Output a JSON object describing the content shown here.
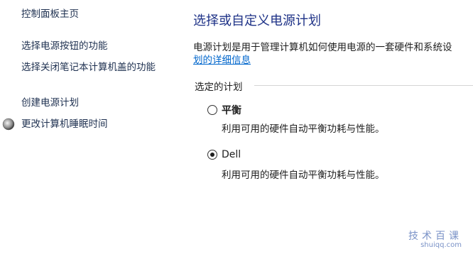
{
  "nav": {
    "home": "控制面板主页",
    "items": [
      {
        "label": "选择电源按钮的功能"
      },
      {
        "label": "选择关闭笔记本计算机盖的功能"
      },
      {
        "label": "创建电源计划"
      },
      {
        "label": "更改计算机睡眠时间",
        "icon": "moon-icon"
      }
    ]
  },
  "main": {
    "title": "选择或自定义电源计划",
    "description": "电源计划是用于管理计算机如何使用电源的一套硬件和系统设",
    "description_link": "划的详细信息",
    "group_label": "选定的计划",
    "plans": [
      {
        "name": "平衡",
        "description": "利用可用的硬件自动平衡功耗与性能。",
        "selected": false
      },
      {
        "name": "Dell",
        "description": "利用可用的硬件自动平衡功耗与性能。",
        "selected": true
      }
    ]
  },
  "watermark": {
    "cn": "技术百课",
    "en": "shuiqq.com"
  },
  "colors": {
    "title": "#1e3287",
    "link": "#0066cc",
    "nav_text": "#1e3050"
  }
}
